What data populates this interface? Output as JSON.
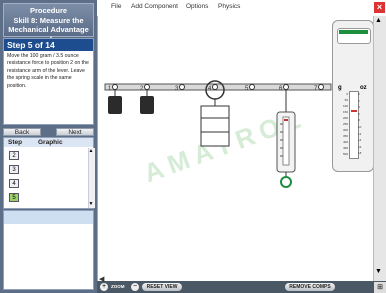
{
  "procedure": {
    "line1": "Procedure",
    "line2": "Skill 8: Measure the",
    "line3": "Mechanical Advantage of"
  },
  "step": {
    "title": "Step 5 of 14",
    "text": "Move the 100 gram / 3.5 ounce resistance force to position 2 on the resistance arm of the lever. Leave the spring scale in the same position."
  },
  "nav": {
    "back": "Back",
    "next": "Next"
  },
  "graphic_panel": {
    "col_step": "Step",
    "col_graphic": "Graphic",
    "steps": [
      "2",
      "3",
      "4",
      "5"
    ],
    "active_step": "5"
  },
  "menu": {
    "file": "File",
    "add_component": "Add Component",
    "options": "Options",
    "physics": "Physics"
  },
  "bottom": {
    "zoom": "ZOOM",
    "reset": "RESET VIEW",
    "remove": "REMOVE COMPS"
  },
  "lever": {
    "positions": [
      "1",
      "2",
      "3",
      "4",
      "5",
      "6",
      "7"
    ]
  },
  "scale": {
    "units_left": "g",
    "units_right": "oz",
    "ticks_g": [
      "0",
      "50",
      "100",
      "150",
      "200",
      "250",
      "300",
      "350",
      "400",
      "450",
      "500"
    ],
    "ticks_oz": [
      "0",
      "2",
      "4",
      "6",
      "8",
      "10",
      "12",
      "14",
      "16",
      "18"
    ]
  },
  "watermark": "AMATROL",
  "colors": {
    "header": "#1e4d8f",
    "panel": "#5d6f86",
    "active": "#9bd06a",
    "accent_green": "#1e8e3e"
  }
}
